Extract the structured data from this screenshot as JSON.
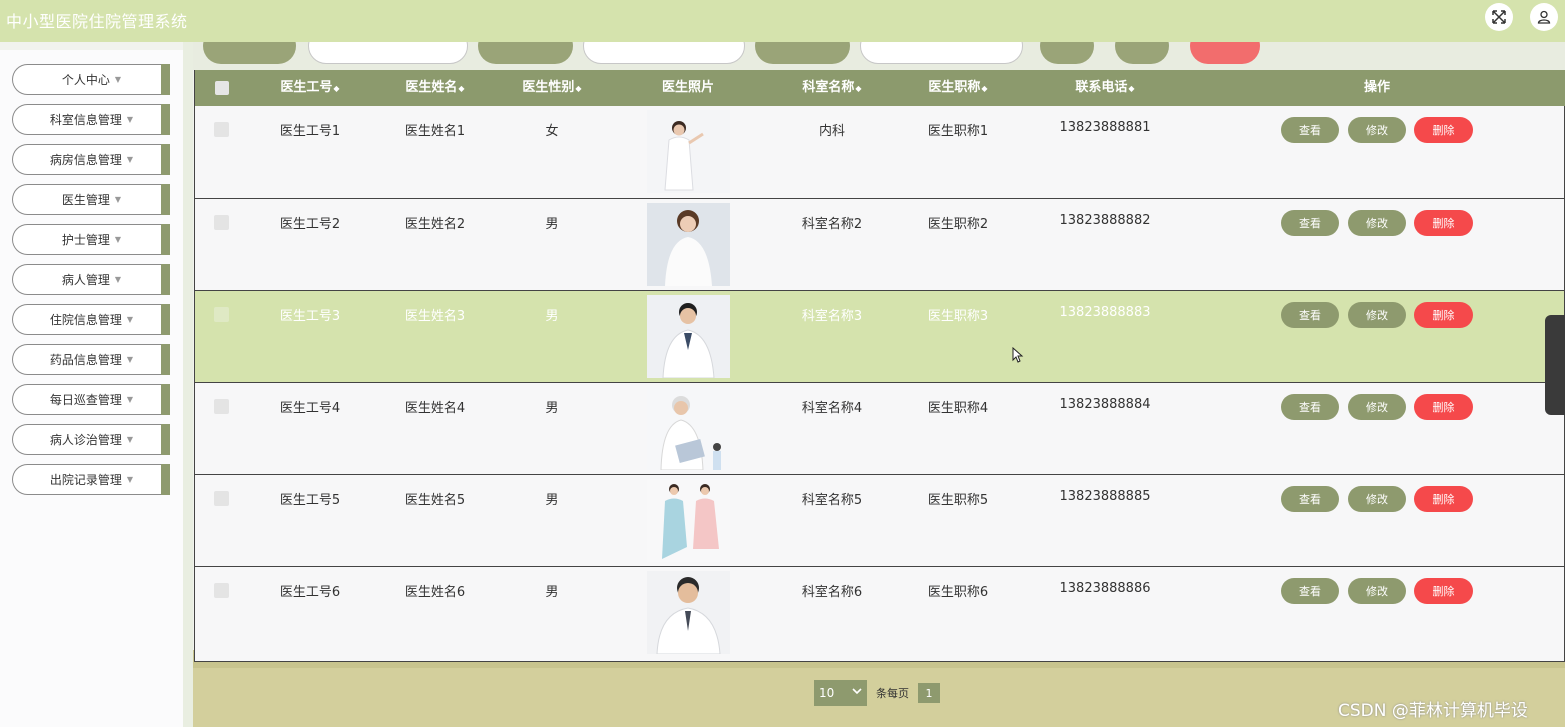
{
  "app": {
    "title": "中小型医院住院管理系统"
  },
  "header_icons": [
    "expand-icon",
    "user-icon"
  ],
  "sidebar": {
    "items": [
      {
        "label": "个人中心"
      },
      {
        "label": "科室信息管理"
      },
      {
        "label": "病房信息管理"
      },
      {
        "label": "医生管理"
      },
      {
        "label": "护士管理"
      },
      {
        "label": "病人管理"
      },
      {
        "label": "住院信息管理"
      },
      {
        "label": "药品信息管理"
      },
      {
        "label": "每日巡查管理"
      },
      {
        "label": "病人诊治管理"
      },
      {
        "label": "出院记录管理"
      }
    ],
    "caret": "▼"
  },
  "table": {
    "columns": {
      "id": "医生工号",
      "name": "医生姓名",
      "gender": "医生性别",
      "photo": "医生照片",
      "dept": "科室名称",
      "title": "医生职称",
      "phone": "联系电话",
      "actions": "操作"
    },
    "sort_glyph": "◆",
    "rows": [
      {
        "id": "医生工号1",
        "name": "医生姓名1",
        "gender": "女",
        "dept": "内科",
        "title": "医生职称1",
        "phone": "13823888881"
      },
      {
        "id": "医生工号2",
        "name": "医生姓名2",
        "gender": "男",
        "dept": "科室名称2",
        "title": "医生职称2",
        "phone": "13823888882"
      },
      {
        "id": "医生工号3",
        "name": "医生姓名3",
        "gender": "男",
        "dept": "科室名称3",
        "title": "医生职称3",
        "phone": "13823888883"
      },
      {
        "id": "医生工号4",
        "name": "医生姓名4",
        "gender": "男",
        "dept": "科室名称4",
        "title": "医生职称4",
        "phone": "13823888884"
      },
      {
        "id": "医生工号5",
        "name": "医生姓名5",
        "gender": "男",
        "dept": "科室名称5",
        "title": "医生职称5",
        "phone": "13823888885"
      },
      {
        "id": "医生工号6",
        "name": "医生姓名6",
        "gender": "男",
        "dept": "科室名称6",
        "title": "医生职称6",
        "phone": "13823888886"
      }
    ],
    "buttons": {
      "view": "查看",
      "edit": "修改",
      "delete": "删除"
    }
  },
  "pagination": {
    "page_size": "10",
    "per_page_label": "条每页",
    "current_page": "1"
  },
  "watermark": "CSDN @菲林计算机毕设",
  "colors": {
    "accent": "#8e9a6e",
    "header_bg": "#d5e3ad",
    "danger": "#f5494b"
  }
}
